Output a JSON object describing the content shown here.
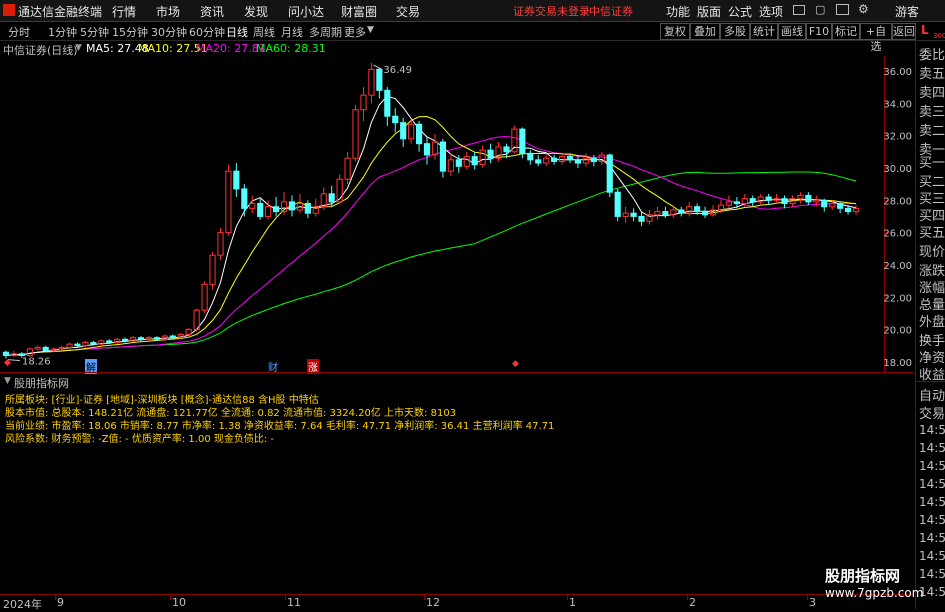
{
  "menubar": {
    "app_title": "通达信金融终端",
    "items": [
      "行情",
      "市场",
      "资讯",
      "发现",
      "问小达",
      "财富圈",
      "交易"
    ],
    "warning": "证券交易未登录",
    "broker": "中信证券",
    "right_items": [
      "功能",
      "版面",
      "公式",
      "选项"
    ],
    "guest": "游客"
  },
  "periods": [
    {
      "label": "分时",
      "active": false
    },
    {
      "label": "1分钟",
      "active": false
    },
    {
      "label": "5分钟",
      "active": false
    },
    {
      "label": "15分钟",
      "active": false
    },
    {
      "label": "30分钟",
      "active": false
    },
    {
      "label": "60分钟",
      "active": false
    },
    {
      "label": "日线",
      "active": true
    },
    {
      "label": "周线",
      "active": false
    },
    {
      "label": "月线",
      "active": false
    },
    {
      "label": "多周期",
      "active": false
    },
    {
      "label": "更多",
      "active": false
    }
  ],
  "toolbar_right": [
    "复权",
    "叠加",
    "多股",
    "统计",
    "画线",
    "F10",
    "标记",
    "+自选",
    "返回"
  ],
  "legend": {
    "stock": "中信证券(日线)",
    "ma5": "MA5: 27.48",
    "ma10": "MA10: 27.51",
    "ma20": "MA20: 27.81",
    "ma60": "MA60: 28.31"
  },
  "colors": {
    "up": "#ff3232",
    "down": "#54ffff",
    "ma5": "#ffffff",
    "ma10": "#ffff00",
    "ma20": "#ff00ff",
    "ma60": "#00ff00",
    "axis": "#8b0000"
  },
  "price_labels": [
    "36.00",
    "34.00",
    "32.00",
    "30.00",
    "28.00",
    "26.00",
    "24.00",
    "22.00",
    "20.00",
    "18.00"
  ],
  "annotations": {
    "high": "36.49",
    "low": "18.26"
  },
  "event_markers": [
    "解",
    "财",
    "涨"
  ],
  "right_panel": {
    "corner": "L",
    "corner_sub": "300",
    "items": [
      "委比",
      "卖五",
      "卖四",
      "卖三",
      "卖二",
      "卖一",
      "买一",
      "买二",
      "买三",
      "买四",
      "买五",
      "现价",
      "涨跌",
      "涨幅",
      "总量",
      "外盘",
      "换手",
      "净资",
      "收益"
    ],
    "mode": "自动",
    "trade": "交易",
    "times": [
      "14:5",
      "14:5",
      "14:5",
      "14:5",
      "14:5",
      "14:5",
      "14:5",
      "14:5",
      "14:5",
      "14:5"
    ]
  },
  "indicator": {
    "title": "股朋指标网",
    "lines": [
      "所属板块: [行业]-证券 [地域]-深圳板块 [概念]-通达信88 含H股 中特估",
      "股本市值: 总股本: 148.21亿 流通盘: 121.77亿 全流通: 0.82 流通市值: 3324.20亿 上市天数: 8103",
      "当前业绩: 市盈率: 18.06 市销率: 8.77 市净率: 1.38 净资收益率: 7.64 毛利率: 47.71 净利润率: 36.41 主营利润率 47.71",
      "风险系数: 财务预警: -Z值: - 优质资产率: 1.00 现金负债比: -"
    ]
  },
  "date_axis": [
    {
      "label": "2024年",
      "tick": false
    },
    {
      "label": "9",
      "tick": true
    },
    {
      "label": "10",
      "tick": true
    },
    {
      "label": "11",
      "tick": true
    },
    {
      "label": "12",
      "tick": true
    },
    {
      "label": "1",
      "tick": true
    },
    {
      "label": "2",
      "tick": true
    },
    {
      "label": "3",
      "tick": true
    }
  ],
  "watermark": {
    "title": "股朋指标网",
    "url": "www.7gpzb.com"
  },
  "chart_data": {
    "type": "candlestick",
    "ylim": [
      17.5,
      36.8
    ],
    "ma_lines": [
      "MA5",
      "MA10",
      "MA20",
      "MA60"
    ],
    "candles": [
      [
        18.6,
        18.4,
        18.7,
        18.2
      ],
      [
        18.4,
        18.5,
        18.7,
        18.3
      ],
      [
        18.5,
        18.4,
        18.6,
        18.26
      ],
      [
        18.4,
        18.8,
        18.9,
        18.3
      ],
      [
        18.8,
        18.9,
        19.0,
        18.7
      ],
      [
        18.9,
        18.7,
        19.0,
        18.6
      ],
      [
        18.7,
        18.8,
        18.9,
        18.6
      ],
      [
        18.8,
        18.9,
        19.0,
        18.7
      ],
      [
        18.9,
        19.1,
        19.2,
        18.8
      ],
      [
        19.1,
        19.0,
        19.2,
        18.9
      ],
      [
        19.0,
        19.2,
        19.3,
        18.9
      ],
      [
        19.2,
        19.1,
        19.3,
        19.0
      ],
      [
        19.1,
        19.3,
        19.4,
        19.0
      ],
      [
        19.3,
        19.2,
        19.4,
        19.1
      ],
      [
        19.2,
        19.4,
        19.5,
        19.1
      ],
      [
        19.4,
        19.3,
        19.5,
        19.2
      ],
      [
        19.3,
        19.5,
        19.6,
        19.2
      ],
      [
        19.5,
        19.4,
        19.6,
        19.3
      ],
      [
        19.4,
        19.5,
        19.6,
        19.3
      ],
      [
        19.5,
        19.4,
        19.6,
        19.3
      ],
      [
        19.4,
        19.6,
        19.7,
        19.3
      ],
      [
        19.6,
        19.5,
        19.7,
        19.4
      ],
      [
        19.5,
        19.7,
        19.8,
        19.4
      ],
      [
        19.7,
        20.0,
        20.1,
        19.6
      ],
      [
        20.0,
        21.2,
        21.3,
        19.9
      ],
      [
        21.2,
        22.8,
        23.0,
        21.0
      ],
      [
        22.8,
        24.6,
        24.8,
        22.5
      ],
      [
        24.6,
        26.0,
        26.3,
        24.3
      ],
      [
        26.0,
        29.8,
        30.2,
        25.8
      ],
      [
        29.8,
        28.7,
        30.3,
        28.2
      ],
      [
        28.7,
        27.5,
        29.0,
        27.0
      ],
      [
        27.5,
        27.8,
        28.3,
        27.2
      ],
      [
        27.8,
        27.0,
        28.1,
        26.8
      ],
      [
        27.0,
        27.6,
        28.0,
        26.8
      ],
      [
        27.6,
        27.3,
        28.2,
        27.0
      ],
      [
        27.3,
        27.9,
        28.5,
        27.1
      ],
      [
        27.9,
        27.4,
        28.3,
        27.0
      ],
      [
        27.4,
        27.8,
        28.4,
        27.2
      ],
      [
        27.8,
        27.2,
        28.0,
        26.9
      ],
      [
        27.2,
        27.6,
        28.1,
        27.0
      ],
      [
        27.6,
        28.4,
        28.8,
        27.4
      ],
      [
        28.4,
        27.9,
        28.9,
        27.6
      ],
      [
        27.9,
        29.3,
        29.6,
        27.8
      ],
      [
        29.3,
        30.6,
        31.0,
        29.0
      ],
      [
        30.6,
        33.6,
        33.9,
        30.4
      ],
      [
        33.6,
        34.5,
        35.0,
        32.9
      ],
      [
        34.5,
        36.1,
        36.49,
        34.0
      ],
      [
        36.1,
        34.8,
        36.2,
        34.3
      ],
      [
        34.8,
        33.2,
        35.0,
        32.6
      ],
      [
        33.2,
        32.8,
        33.7,
        32.2
      ],
      [
        32.8,
        31.8,
        33.1,
        31.3
      ],
      [
        31.8,
        32.7,
        33.0,
        31.5
      ],
      [
        32.7,
        31.5,
        32.9,
        31.0
      ],
      [
        31.5,
        30.8,
        31.9,
        30.2
      ],
      [
        30.8,
        31.6,
        32.1,
        30.5
      ],
      [
        31.6,
        29.8,
        31.8,
        29.4
      ],
      [
        29.8,
        30.5,
        30.9,
        29.5
      ],
      [
        30.5,
        30.1,
        30.8,
        29.7
      ],
      [
        30.1,
        30.7,
        31.0,
        29.9
      ],
      [
        30.7,
        30.2,
        31.0,
        29.9
      ],
      [
        30.2,
        31.1,
        31.4,
        30.0
      ],
      [
        31.1,
        30.6,
        31.5,
        30.3
      ],
      [
        30.6,
        31.3,
        31.6,
        30.4
      ],
      [
        31.3,
        31.0,
        31.5,
        30.6
      ],
      [
        31.0,
        32.4,
        32.6,
        30.9
      ],
      [
        32.4,
        30.9,
        32.5,
        30.6
      ],
      [
        30.9,
        30.5,
        31.1,
        30.2
      ],
      [
        30.5,
        30.3,
        30.8,
        30.1
      ],
      [
        30.3,
        30.6,
        30.9,
        30.1
      ],
      [
        30.6,
        30.4,
        30.8,
        30.2
      ],
      [
        30.4,
        30.7,
        30.9,
        30.2
      ],
      [
        30.7,
        30.5,
        30.9,
        30.3
      ],
      [
        30.5,
        30.3,
        30.8,
        30.0
      ],
      [
        30.3,
        30.6,
        30.9,
        30.1
      ],
      [
        30.6,
        30.4,
        30.8,
        30.1
      ],
      [
        30.4,
        30.8,
        31.0,
        30.2
      ],
      [
        30.8,
        28.5,
        30.9,
        28.2
      ],
      [
        28.5,
        27.0,
        28.7,
        26.7
      ],
      [
        27.0,
        27.2,
        27.6,
        26.6
      ],
      [
        27.2,
        27.0,
        27.5,
        26.7
      ],
      [
        27.0,
        26.7,
        27.3,
        26.4
      ],
      [
        26.7,
        27.1,
        27.4,
        26.5
      ],
      [
        27.1,
        27.3,
        27.6,
        26.8
      ],
      [
        27.3,
        27.1,
        27.6,
        26.9
      ],
      [
        27.1,
        27.4,
        27.7,
        26.9
      ],
      [
        27.4,
        27.2,
        27.6,
        27.0
      ],
      [
        27.2,
        27.6,
        27.9,
        27.0
      ],
      [
        27.6,
        27.3,
        27.8,
        27.1
      ],
      [
        27.3,
        27.1,
        27.6,
        26.9
      ],
      [
        27.1,
        27.4,
        27.7,
        27.0
      ],
      [
        27.4,
        27.7,
        28.0,
        27.2
      ],
      [
        27.7,
        27.9,
        28.3,
        27.5
      ],
      [
        27.9,
        27.8,
        28.2,
        27.5
      ],
      [
        27.8,
        28.1,
        28.4,
        27.6
      ],
      [
        28.1,
        27.9,
        28.3,
        27.6
      ],
      [
        27.9,
        28.2,
        28.4,
        27.7
      ],
      [
        28.2,
        28.0,
        28.4,
        27.7
      ],
      [
        28.0,
        28.1,
        28.4,
        27.8
      ],
      [
        28.1,
        27.8,
        28.3,
        27.5
      ],
      [
        27.8,
        28.1,
        28.3,
        27.6
      ],
      [
        28.1,
        28.3,
        28.5,
        27.8
      ],
      [
        28.3,
        27.9,
        28.5,
        27.7
      ],
      [
        27.9,
        28.0,
        28.3,
        27.6
      ],
      [
        28.0,
        27.6,
        28.1,
        27.3
      ],
      [
        27.6,
        27.8,
        28.0,
        27.4
      ],
      [
        27.8,
        27.5,
        27.9,
        27.2
      ],
      [
        27.5,
        27.3,
        27.7,
        27.1
      ],
      [
        27.3,
        27.48,
        27.7,
        27.1
      ]
    ]
  }
}
